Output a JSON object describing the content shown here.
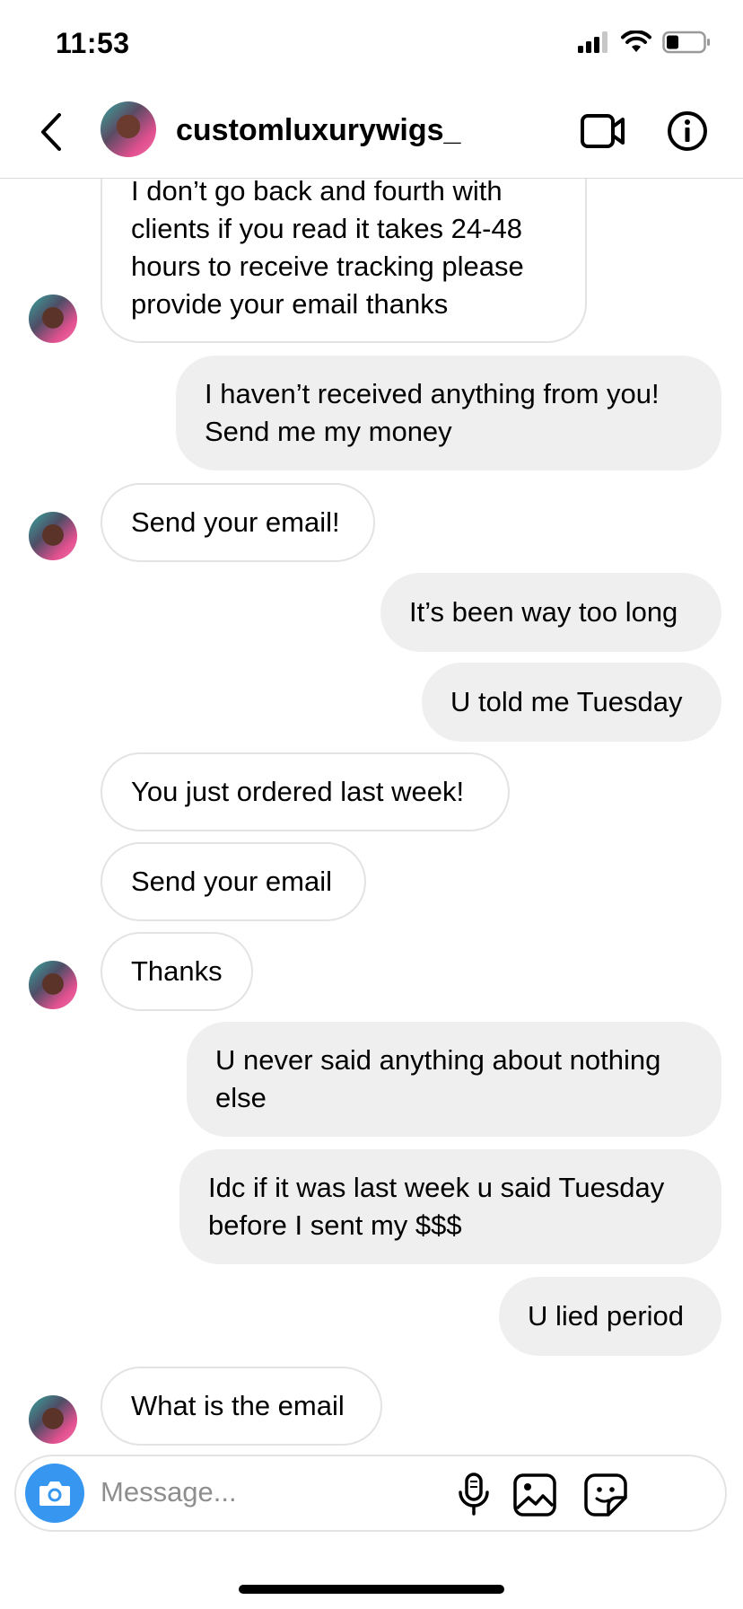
{
  "status_bar": {
    "time": "11:53"
  },
  "header": {
    "username": "customluxurywigs_"
  },
  "messages": [
    {
      "side": "in",
      "text": "I don’t go back and fourth with clients if you read it takes 24-48 hours to receive tracking please provide your email thanks"
    },
    {
      "side": "out",
      "text": "I haven’t received anything from you! Send me my money"
    },
    {
      "side": "in",
      "text": "Send your email!"
    },
    {
      "side": "out",
      "text": "It’s been way too long"
    },
    {
      "side": "out",
      "text": "U told me Tuesday"
    },
    {
      "side": "in",
      "text": "You just ordered last week!"
    },
    {
      "side": "in",
      "text": "Send your email"
    },
    {
      "side": "in",
      "text": "Thanks"
    },
    {
      "side": "out",
      "text": "U never said anything about nothing else"
    },
    {
      "side": "out",
      "text": "Idc if it was last week u said Tuesday before I sent my $$$"
    },
    {
      "side": "out",
      "text": "U lied period"
    },
    {
      "side": "in",
      "text": "What is the email"
    }
  ],
  "composer": {
    "placeholder": "Message..."
  },
  "icons": {
    "back": "chevron-left-icon",
    "video": "video-call-icon",
    "info": "info-icon",
    "camera": "camera-icon",
    "mic": "microphone-icon",
    "gallery": "gallery-icon",
    "sticker": "sticker-icon"
  },
  "colors": {
    "accent": "#3797f0",
    "outgoing_bubble": "#efefef",
    "incoming_border": "#e3e3e3"
  }
}
